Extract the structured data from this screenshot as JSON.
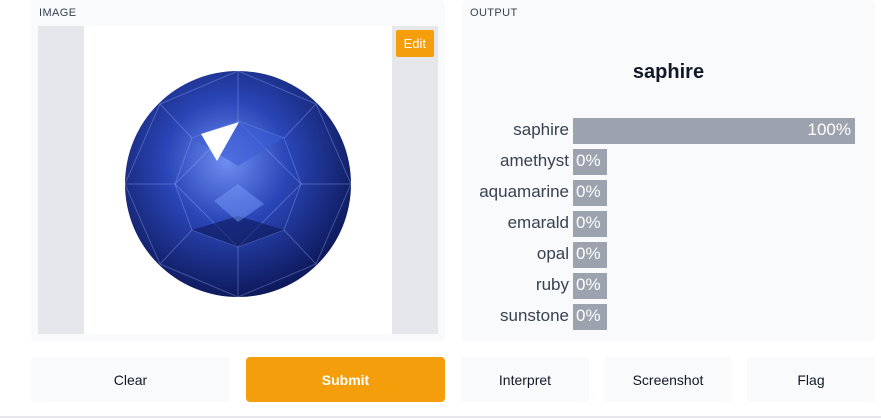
{
  "input": {
    "label": "IMAGE",
    "edit_label": "Edit",
    "image_subject": "blue round-cut sapphire gemstone"
  },
  "output": {
    "label": "OUTPUT",
    "prediction": "saphire",
    "results": [
      {
        "name": "saphire",
        "percent": "100%",
        "fraction": 1.0
      },
      {
        "name": "amethyst",
        "percent": "0%",
        "fraction": 0.0
      },
      {
        "name": "aquamarine",
        "percent": "0%",
        "fraction": 0.0
      },
      {
        "name": "emarald",
        "percent": "0%",
        "fraction": 0.0
      },
      {
        "name": "opal",
        "percent": "0%",
        "fraction": 0.0
      },
      {
        "name": "ruby",
        "percent": "0%",
        "fraction": 0.0
      },
      {
        "name": "sunstone",
        "percent": "0%",
        "fraction": 0.0
      }
    ]
  },
  "actions": {
    "clear": "Clear",
    "submit": "Submit",
    "interpret": "Interpret",
    "screenshot": "Screenshot",
    "flag": "Flag"
  },
  "colors": {
    "accent": "#f59e0b",
    "bar": "#9ca3af",
    "panel": "#f9fafb",
    "gem_dark": "#0f1a5c",
    "gem_mid": "#2a46b8",
    "gem_light": "#6f8ef0"
  }
}
